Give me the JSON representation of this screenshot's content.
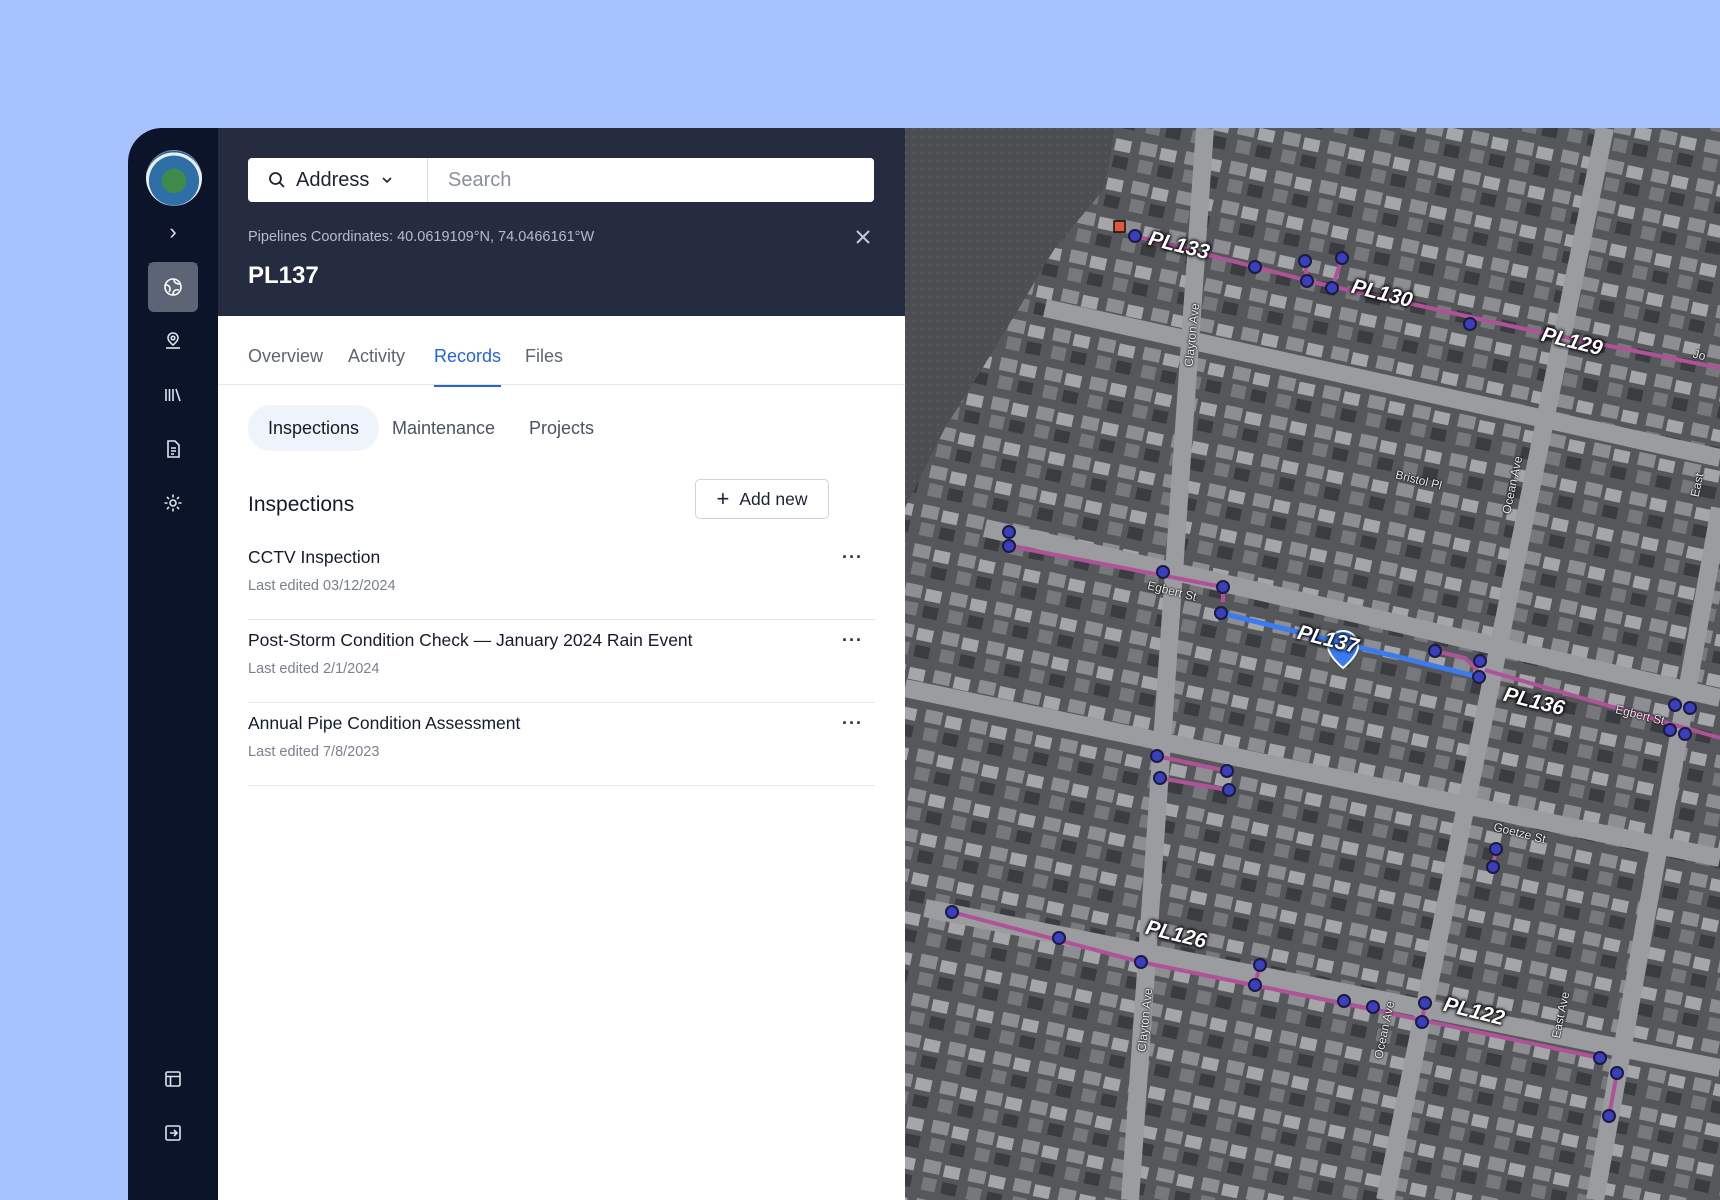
{
  "search": {
    "type_label": "Address",
    "placeholder": "Search"
  },
  "header": {
    "coordinates": "Pipelines Coordinates: 40.0619109°N, 74.0466161°W",
    "title": "PL137"
  },
  "tabs": [
    "Overview",
    "Activity",
    "Records",
    "Files"
  ],
  "active_tab": "Records",
  "subtabs": [
    "Inspections",
    "Maintenance",
    "Projects"
  ],
  "active_subtab": "Inspections",
  "section": {
    "title": "Inspections",
    "add_label": "Add new"
  },
  "inspections": [
    {
      "title": "CCTV Inspection",
      "edited": "Last edited 03/12/2024"
    },
    {
      "title": "Post-Storm Condition Check — January 2024 Rain Event",
      "edited": "Last edited 2/1/2024"
    },
    {
      "title": "Annual Pipe Condition Assessment",
      "edited": "Last edited 7/8/2023"
    }
  ],
  "map": {
    "pipelines": [
      "PL133",
      "PL130",
      "PL129",
      "PL137",
      "PL136",
      "PL126",
      "PL122"
    ],
    "streets": [
      "Clayton Ave",
      "Bristol Pl",
      "Ocean Ave",
      "Egbert St",
      "Egbert St",
      "Goetze St",
      "Clayton Ave",
      "Ocean Ave",
      "East Ave",
      "Jo",
      "East"
    ],
    "selected_color": "#3b7bf0",
    "pipeline_color": "#b0529a"
  },
  "sidebar_icons": [
    "globe-icon",
    "user-pin-icon",
    "library-icon",
    "document-icon",
    "gear-icon",
    "layout-icon",
    "logout-icon"
  ]
}
